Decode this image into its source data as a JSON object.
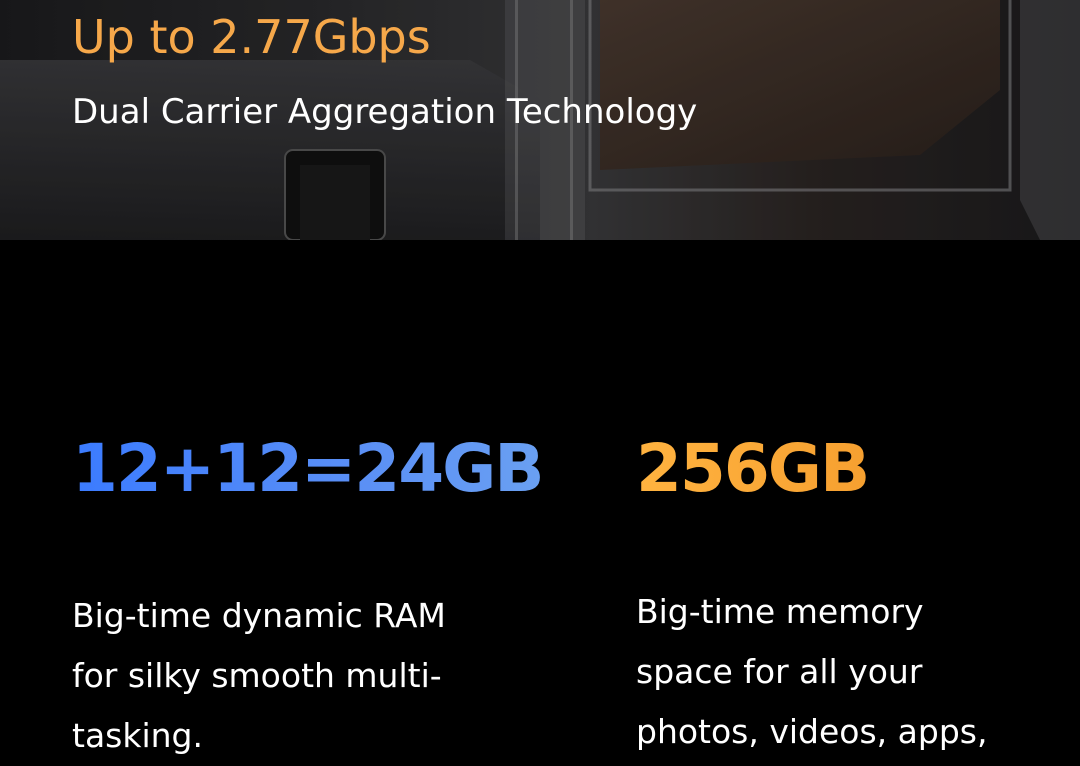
{
  "hero": {
    "title": "Up to 2.77Gbps",
    "subtitle": "Dual Carrier Aggregation Technology"
  },
  "specs": [
    {
      "value": "12+12=24GB",
      "description": "Big-time dynamic RAM for silky smooth multi-tasking.",
      "accent_color": "#3b7bff"
    },
    {
      "value": "256GB",
      "description": "Big-time memory space for all your photos, videos, apps,",
      "accent_color": "#ffb340"
    }
  ]
}
